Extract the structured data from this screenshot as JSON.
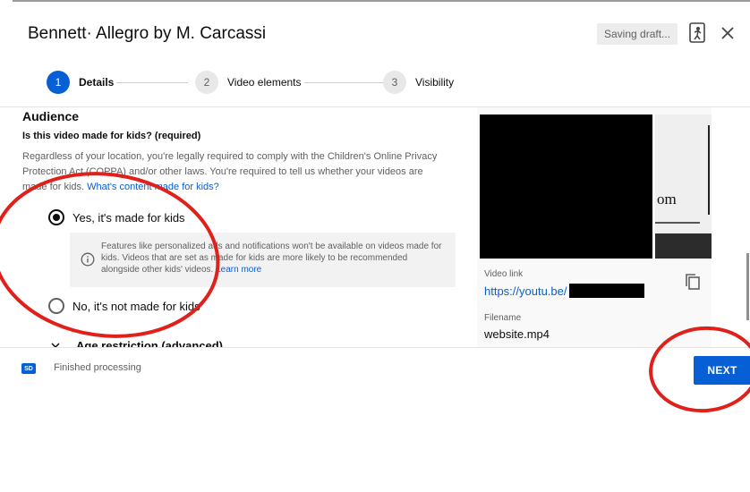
{
  "header": {
    "title_prefix": "Bennett",
    "title_suffix": "· Allegro by M. Carcassi",
    "saving_status": "Saving draft...",
    "feedback_icon": "feedback-icon",
    "close_icon": "close-icon"
  },
  "stepper": {
    "steps": [
      {
        "number": "1",
        "label": "Details"
      },
      {
        "number": "2",
        "label": "Video elements"
      },
      {
        "number": "3",
        "label": "Visibility"
      }
    ]
  },
  "audience": {
    "heading": "Audience",
    "question": "Is this video made for kids? (required)",
    "description": "Regardless of your location, you're legally required to comply with the Children's Online Privacy Protection Act (COPPA) and/or other laws. You're required to tell us whether your videos are made for kids.",
    "description_link": "What's content made for kids?",
    "option_yes": "Yes, it's made for kids",
    "option_no": "No, it's not made for kids",
    "info_text": "Features like personalized ads and notifications won't be available on videos made for kids. Videos that are set as made for kids are more likely to be recommended alongside other kids' videos.",
    "info_link": "Learn more",
    "age_restriction": "Age restriction (advanced)"
  },
  "video": {
    "frame_text": "om",
    "link_label": "Video link",
    "link_value": "https://youtu.be/",
    "filename_label": "Filename",
    "filename_value": "website.mp4"
  },
  "footer": {
    "badge": "SD",
    "status": "Finished processing",
    "next_label": "NEXT"
  },
  "colors": {
    "accent": "#065fd4",
    "annotation": "#e0201b"
  }
}
